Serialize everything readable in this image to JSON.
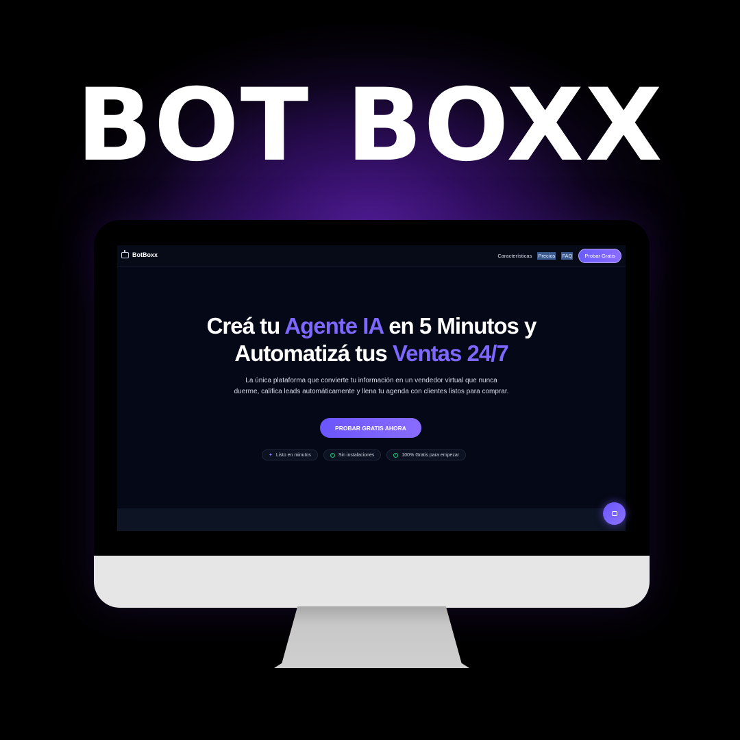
{
  "poster": {
    "title": "BOT BOXX"
  },
  "nav": {
    "brand": "BotBoxx",
    "links": [
      "Características",
      "Precios",
      "FAQ"
    ],
    "cta": "Probar Gratis"
  },
  "hero": {
    "title_line1_a": "Creá tu ",
    "title_line1_accent": "Agente IA",
    "title_line1_b": " en 5 Minutos y",
    "title_line2_a": "Automatizá tus ",
    "title_line2_accent": "Ventas 24/7",
    "subtitle": "La única plataforma que convierte tu información en un vendedor virtual que nunca duerme, califica leads automáticamente y llena tu agenda con clientes listos para comprar.",
    "cta": "PROBAR GRATIS AHORA",
    "badges": [
      "Listo en minutos",
      "Sin instalaciones",
      "100% Gratis para empezar"
    ]
  },
  "colors": {
    "accent": "#7d67ff",
    "background": "#050816",
    "success": "#25c07a"
  },
  "icons": {
    "brand": "bot-icon",
    "chat": "chat-bubble-icon",
    "badge_1": "lightning-icon",
    "badge_2": "check-circle-icon",
    "badge_3": "check-circle-icon"
  }
}
